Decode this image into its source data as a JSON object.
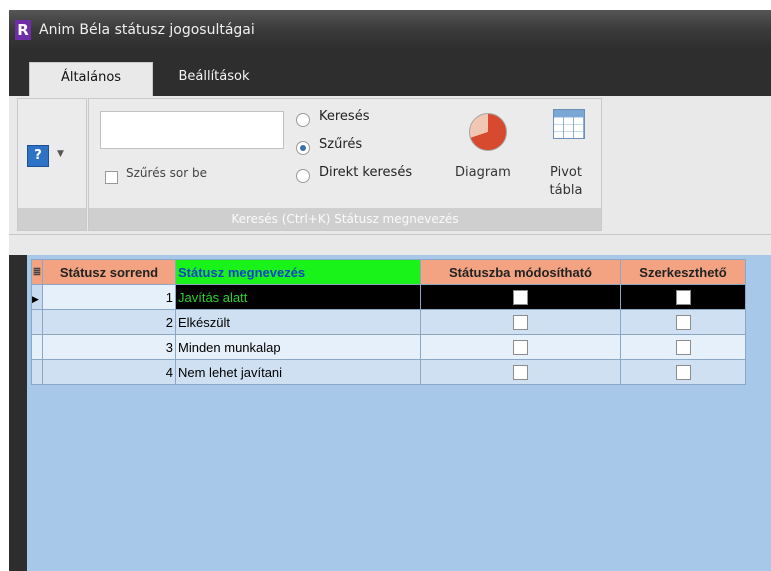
{
  "window": {
    "title": "Anim Béla státusz jogosultágai",
    "logo": "R"
  },
  "tabs": [
    "Általános",
    "Beállítások"
  ],
  "ribbon": {
    "help_icon": "?",
    "search": {
      "value": "",
      "placeholder": ""
    },
    "filter_checkbox_label": "Szűrés sor be",
    "search_modes": [
      {
        "label": "Keresés",
        "selected": false
      },
      {
        "label": "Szűrés",
        "selected": true
      },
      {
        "label": "Direkt keresés",
        "selected": false
      }
    ],
    "diagram_label": "Diagram",
    "pivot_label_1": "Pivot",
    "pivot_label_2": "tábla",
    "group_caption": "Keresés (Ctrl+K) Státusz megnevezés"
  },
  "grid": {
    "columns": [
      "Státusz sorrend",
      "Státusz megnevezés",
      "Státuszba módosítható",
      "Szerkeszthető"
    ],
    "rows": [
      {
        "order": "1",
        "name": "Javítás alatt",
        "modifiable": false,
        "editable": false
      },
      {
        "order": "2",
        "name": "Elkészült",
        "modifiable": false,
        "editable": false
      },
      {
        "order": "3",
        "name": "Minden munkalap",
        "modifiable": false,
        "editable": false
      },
      {
        "order": "4",
        "name": "Nem lehet javítani",
        "modifiable": false,
        "editable": false
      }
    ]
  },
  "colors": {
    "header_bg": "#f3a382",
    "name_header_bg": "#19f319",
    "name_header_text": "#0b44c8",
    "selected_row_bg": "#000000",
    "selected_name_text": "#2ed12e",
    "grid_bg": "#a8c8e9"
  }
}
